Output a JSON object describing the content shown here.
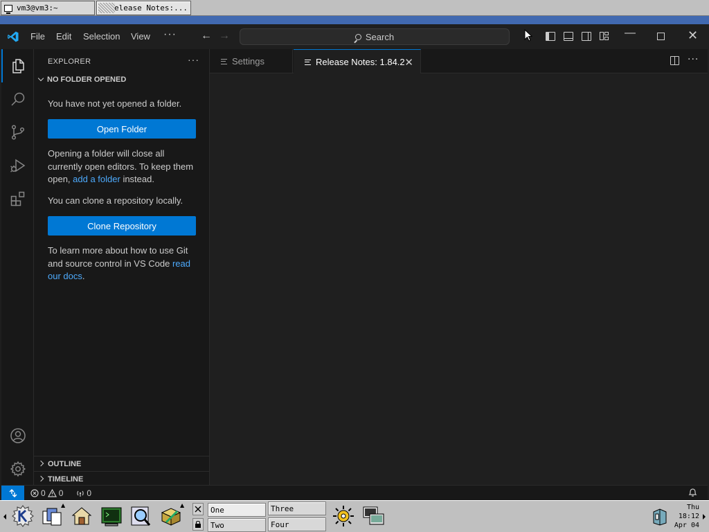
{
  "x_taskbar": {
    "tasks": [
      {
        "label": "vm3@vm3:~"
      },
      {
        "label": "Release Notes:..."
      }
    ]
  },
  "titlebar": {
    "menu": [
      "File",
      "Edit",
      "Selection",
      "View",
      "···"
    ],
    "search_label": "Search",
    "back_glyph": "←",
    "forward_glyph": "→",
    "minimize_glyph": "—",
    "close_glyph": "✕"
  },
  "activity_bar": {
    "icons": [
      "files-icon",
      "search-icon",
      "source-control-icon",
      "run-debug-icon",
      "extensions-icon",
      "account-icon",
      "manage-gear-icon"
    ]
  },
  "sidebar": {
    "title": "EXPLORER",
    "more": "···",
    "section": "NO FOLDER OPENED",
    "not_opened": "You have not yet opened a folder.",
    "open_folder_button": "Open Folder",
    "warning_prefix": "Opening a folder will close all currently open editors. To keep them open, ",
    "warning_link": "add a folder",
    "warning_suffix": " instead.",
    "clone_text": "You can clone a repository locally.",
    "clone_button": "Clone Repository",
    "git_prefix": "To learn more about how to use Git and source control in VS Code ",
    "git_link": "read our docs",
    "git_suffix": ".",
    "outline": "OUTLINE",
    "timeline": "TIMELINE"
  },
  "editor": {
    "tabs": [
      {
        "label": "Settings",
        "active": false
      },
      {
        "label": "Release Notes: 1.84.2",
        "active": true
      }
    ],
    "tab_close_glyph": "✕",
    "more": "···"
  },
  "statusbar": {
    "errors": "0",
    "warnings": "0",
    "ports": "0"
  },
  "panel": {
    "desktops": [
      "One",
      "Two",
      "Three",
      "Four"
    ],
    "clock": {
      "day": "Thu",
      "time": "18:12",
      "date": "Apr 04"
    }
  },
  "colors": {
    "accent": "#0078d4",
    "link": "#4daafc",
    "window_border": "#4169b0",
    "panel_gray": "#c0c0c0"
  }
}
